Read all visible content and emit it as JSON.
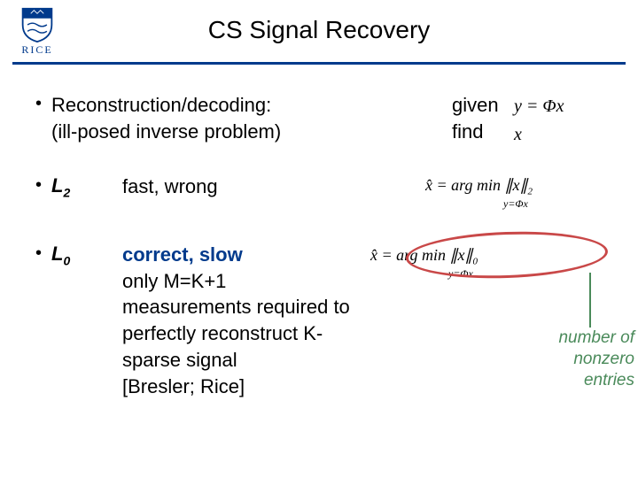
{
  "logo": {
    "text": "RICE"
  },
  "title": "CS Signal Recovery",
  "bullet1": {
    "heading": "Reconstruction/decoding:",
    "sub": "(ill-posed inverse problem)",
    "given": "given",
    "find": "find",
    "eq_given": "y = Φx",
    "eq_find": "x"
  },
  "bullet2": {
    "label_main": "L",
    "label_sub": "2",
    "text": "fast, wrong",
    "eq": "x̂ = arg min ∥x∥",
    "eq_sub": "2",
    "constraint": "y=Φx"
  },
  "bullet3": {
    "label_main": "L",
    "label_sub": "0",
    "text_blue": "correct, slow",
    "text_body": "only M=K+1 measurements required to perfectly reconstruct K-sparse signal",
    "text_ref": "[Bresler; Rice]",
    "eq": "x̂ = arg min ∥x∥",
    "eq_sub": "0",
    "constraint": "y=Φx"
  },
  "callout": {
    "line1": "number of",
    "line2": "nonzero",
    "line3": "entries"
  }
}
